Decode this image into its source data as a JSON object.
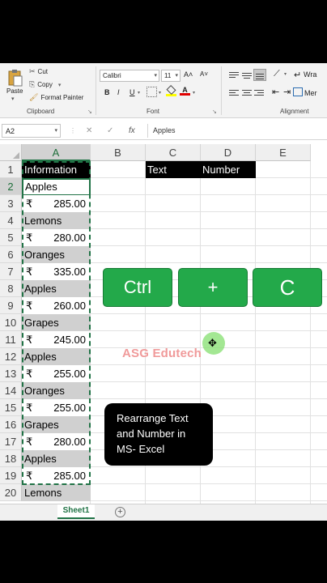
{
  "ribbon": {
    "clipboard": {
      "paste": "Paste",
      "cut": "Cut",
      "copy": "Copy",
      "format_painter": "Format Painter",
      "group_label": "Clipboard"
    },
    "font": {
      "font_name": "Calibri",
      "font_size": "11",
      "bold": "B",
      "italic": "I",
      "underline": "U",
      "font_color_glyph": "A",
      "grow": "A˄",
      "shrink": "A˅",
      "group_label": "Font"
    },
    "alignment": {
      "wrap": "Wra",
      "merge": "Mer",
      "group_label": "Alignment"
    }
  },
  "formula_bar": {
    "name_box": "A2",
    "fx": "fx",
    "cancel": "✕",
    "enter": "✓",
    "value": "Apples"
  },
  "columns": [
    "A",
    "B",
    "C",
    "D",
    "E"
  ],
  "rows": [
    "1",
    "2",
    "3",
    "4",
    "5",
    "6",
    "7",
    "8",
    "9",
    "10",
    "11",
    "12",
    "13",
    "14",
    "15",
    "16",
    "17",
    "18",
    "19",
    "20"
  ],
  "cells": {
    "A1": "Information",
    "C1": "Text",
    "D1": "Number",
    "currency": "₹",
    "column_a": [
      {
        "type": "text",
        "value": "Apples"
      },
      {
        "type": "num",
        "value": "285.00"
      },
      {
        "type": "text",
        "value": "Lemons"
      },
      {
        "type": "num",
        "value": "280.00"
      },
      {
        "type": "text",
        "value": "Oranges"
      },
      {
        "type": "num",
        "value": "335.00"
      },
      {
        "type": "text",
        "value": "Apples"
      },
      {
        "type": "num",
        "value": "260.00"
      },
      {
        "type": "text",
        "value": "Grapes"
      },
      {
        "type": "num",
        "value": "245.00"
      },
      {
        "type": "text",
        "value": "Apples"
      },
      {
        "type": "num",
        "value": "255.00"
      },
      {
        "type": "text",
        "value": "Oranges"
      },
      {
        "type": "num",
        "value": "255.00"
      },
      {
        "type": "text",
        "value": "Grapes"
      },
      {
        "type": "num",
        "value": "280.00"
      },
      {
        "type": "text",
        "value": "Apples"
      },
      {
        "type": "num",
        "value": "285.00"
      },
      {
        "type": "text",
        "value": "Lemons"
      }
    ]
  },
  "overlay": {
    "keys": [
      "Ctrl",
      "+",
      "C"
    ],
    "watermark": "ASG Edutech",
    "note": "Rearrange Text and Number in MS- Excel"
  },
  "sheet_tabs": {
    "active": "Sheet1",
    "add": "+"
  },
  "colors": {
    "excel_green": "#217346",
    "key_green": "#23a94a",
    "text_fill": "#d0d0d0"
  }
}
